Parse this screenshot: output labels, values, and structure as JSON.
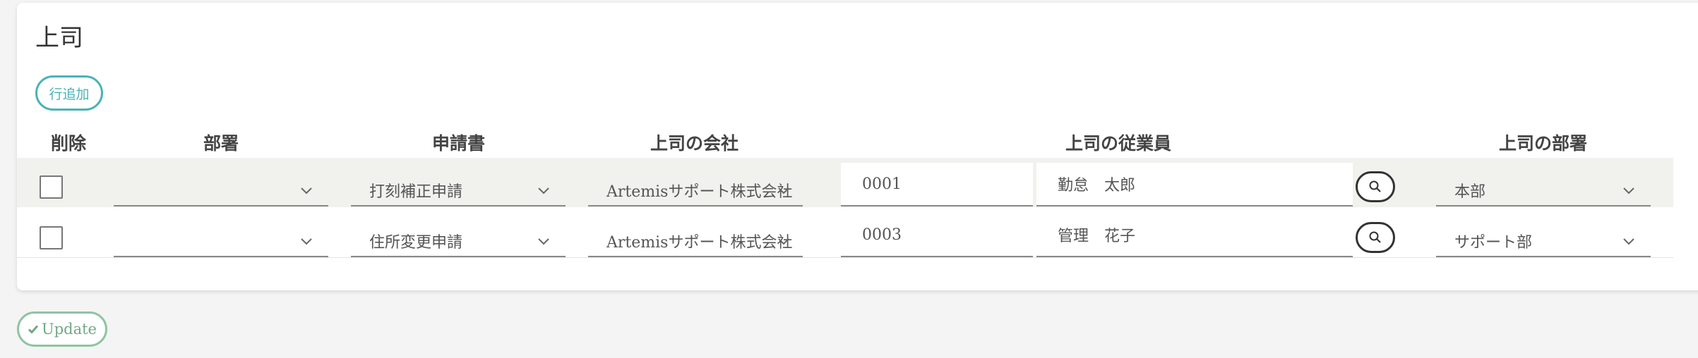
{
  "section": {
    "title": "上司",
    "add_row_label": "行追加"
  },
  "table": {
    "headers": {
      "delete": "削除",
      "department": "部署",
      "application": "申請書",
      "boss_company": "上司の会社",
      "boss_employee": "上司の従業員",
      "boss_department": "上司の部署"
    },
    "rows": [
      {
        "department": "",
        "application": "打刻補正申請",
        "company": "Artemisサポート株式会社",
        "employee_code": "0001",
        "employee_name": "勤怠　太郎",
        "boss_department": "本部"
      },
      {
        "department": "",
        "application": "住所変更申請",
        "company": "Artemisサポート株式会社",
        "employee_code": "0003",
        "employee_name": "管理　花子",
        "boss_department": "サポート部"
      }
    ]
  },
  "footer": {
    "update_label": "Update"
  },
  "icons": {
    "dropdown": "chevron-down-icon",
    "search": "search-icon",
    "update": "check-icon"
  },
  "colors": {
    "add_row_accent": "#4ab3b8",
    "update_accent": "#6fa886",
    "row_highlight": "#f1f1ee"
  }
}
